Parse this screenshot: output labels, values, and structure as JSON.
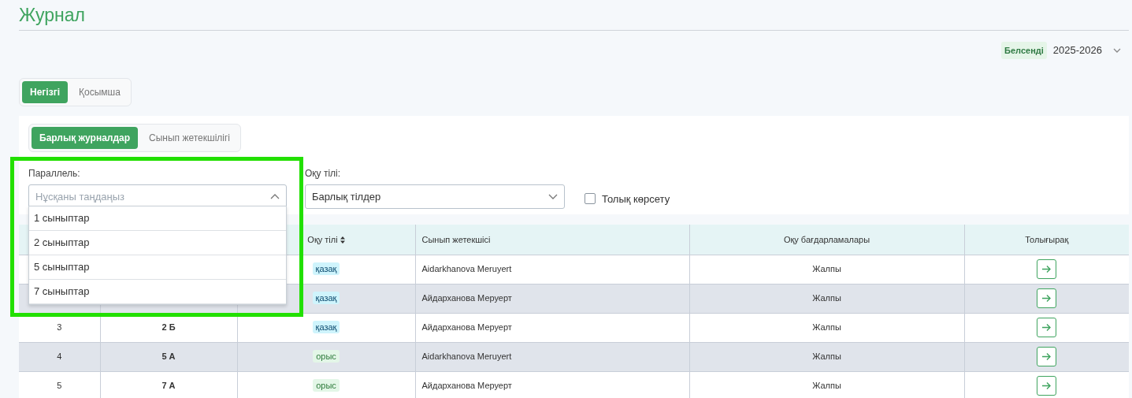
{
  "title": "Журнал",
  "period": {
    "status": "Белсенді",
    "year": "2025-2026"
  },
  "main_tabs": [
    {
      "label": "Негізгі",
      "selected": true
    },
    {
      "label": "Қосымша",
      "selected": false
    }
  ],
  "sub_tabs": [
    {
      "label": "Барлық журналдар",
      "selected": true
    },
    {
      "label": "Сынып жетекшілігі",
      "selected": false
    }
  ],
  "filters": {
    "parallel": {
      "label": "Параллель:",
      "placeholder": "Нұсқаны таңдаңыз",
      "expanded": true,
      "highlighted": true,
      "options": [
        "1 сыныптар",
        "2 сыныптар",
        "5 сыныптар",
        "7 сыныптар"
      ]
    },
    "language": {
      "label": "Оқу тілі:",
      "value": "Барлық тілдер"
    },
    "full_view": {
      "label": "Толық көрсету",
      "checked": false
    }
  },
  "table": {
    "columns": [
      {},
      {},
      {
        "label": "Оқу тілі",
        "sortable": true
      },
      {
        "label": "Сынып жетекшісі"
      },
      {
        "label": "Оқу бағдарламалары"
      },
      {
        "label": "Толығырақ"
      }
    ],
    "rows": [
      {
        "language": "қазақ",
        "color": "#cff4fc",
        "teacher": "Aidarkhanova Meruyert",
        "program": "Жалпы"
      },
      {
        "language": "қазақ",
        "color": "#cff4fc",
        "teacher": "Айдарханова Меруерт",
        "program": "Жалпы"
      },
      {
        "number": "3",
        "class": "2 Б",
        "language": "қазақ",
        "color": "#cff4fc",
        "teacher": "Айдарханова Меруерт",
        "program": "Жалпы"
      },
      {
        "number": "4",
        "class": "5 А",
        "language": "орыс",
        "color": "#e3f6e7",
        "teacher": "Aidarkhanova Meruyert",
        "program": "Жалпы"
      },
      {
        "number": "5",
        "class": "7 А",
        "language": "орыс",
        "color": "#e3f6e7",
        "teacher": "Айдарханова Меруерт",
        "program": "Жалпы"
      }
    ]
  }
}
